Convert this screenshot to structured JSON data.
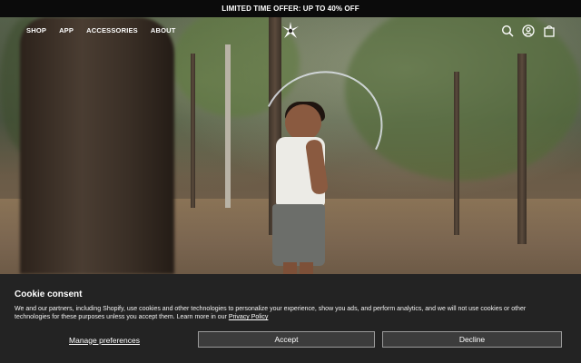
{
  "announcement": {
    "text": "LIMITED TIME OFFER: UP TO 40% OFF"
  },
  "nav": {
    "items": [
      {
        "label": "SHOP"
      },
      {
        "label": "APP"
      },
      {
        "label": "ACCESSORIES"
      },
      {
        "label": "ABOUT"
      }
    ],
    "logo_icon": "star-burst-logo-icon",
    "icons": [
      "search-icon",
      "account-icon",
      "cart-bag-icon"
    ]
  },
  "hero": {
    "image": "man-jumping-rope-in-forest"
  },
  "cookie_banner": {
    "title": "Cookie consent",
    "body_text": "We and our partners, including Shopify, use cookies and other technologies to personalize your experience, show you ads, and perform analytics, and we will not use cookies or other technologies for these purposes unless you accept them. Learn more in our ",
    "privacy_link": "Privacy Policy",
    "manage_label": "Manage preferences",
    "accept_label": "Accept",
    "decline_label": "Decline"
  }
}
